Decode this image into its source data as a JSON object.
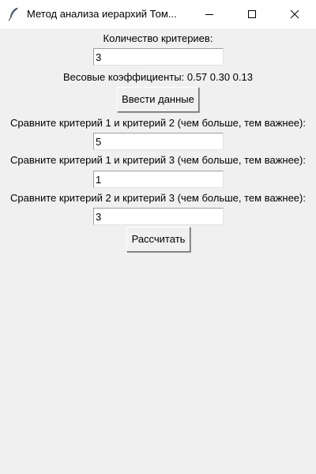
{
  "window": {
    "title": "Метод анализа иерархий Том...",
    "icon": "feather-icon"
  },
  "form": {
    "criteria_count_label": "Количество критериев:",
    "criteria_count_value": "3",
    "weights_text": "Весовые коэффициенты: 0.57 0.30 0.13",
    "enter_button": "Ввести данные",
    "comparisons": [
      {
        "label": "Сравните критерий 1 и критерий 2 (чем больше, тем важнее):",
        "value": "5"
      },
      {
        "label": "Сравните критерий 1 и критерий 3 (чем больше, тем важнее):",
        "value": "1"
      },
      {
        "label": "Сравните критерий 2 и критерий 3 (чем больше, тем важнее):",
        "value": "3"
      }
    ],
    "calculate_button": "Рассчитать"
  },
  "colors": {
    "background": "#f0f0f0",
    "titlebar": "#ffffff",
    "entry_background": "#ffffff"
  }
}
